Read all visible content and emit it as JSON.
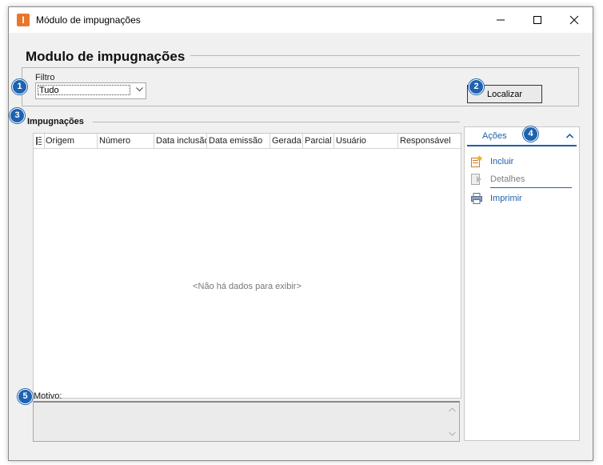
{
  "window": {
    "title": "Módulo de impugnações",
    "icon": "app-logo-icon",
    "icon_letter": "I",
    "controls": [
      "minimize-icon",
      "maximize-icon",
      "close-icon"
    ]
  },
  "page": {
    "heading": "Modulo de impugnações"
  },
  "filter": {
    "label": "Filtro",
    "selected": "Tudo",
    "search_button": "Localizar"
  },
  "impugnacoes": {
    "section_title": "Impugnações",
    "columns": [
      "Origem",
      "Número",
      "Data inclusão",
      "Data emissão",
      "Gerada",
      "Parcial",
      "Usuário",
      "Responsável"
    ],
    "empty_message": "<Não há dados para exibir>"
  },
  "actions": {
    "title": "Ações",
    "items": [
      {
        "label": "Incluir",
        "icon": "add-document-icon",
        "enabled": true
      },
      {
        "label": "Detalhes",
        "icon": "details-document-icon",
        "enabled": false
      },
      {
        "label": "Imprimir",
        "icon": "printer-icon",
        "enabled": true
      }
    ]
  },
  "motivo": {
    "label": "Motivo:",
    "value": ""
  },
  "badges": [
    "1",
    "2",
    "3",
    "4",
    "5"
  ],
  "colors": {
    "accent": "#1f5fa6",
    "badge": "#1e62b0",
    "app_icon": "#e8762b"
  }
}
